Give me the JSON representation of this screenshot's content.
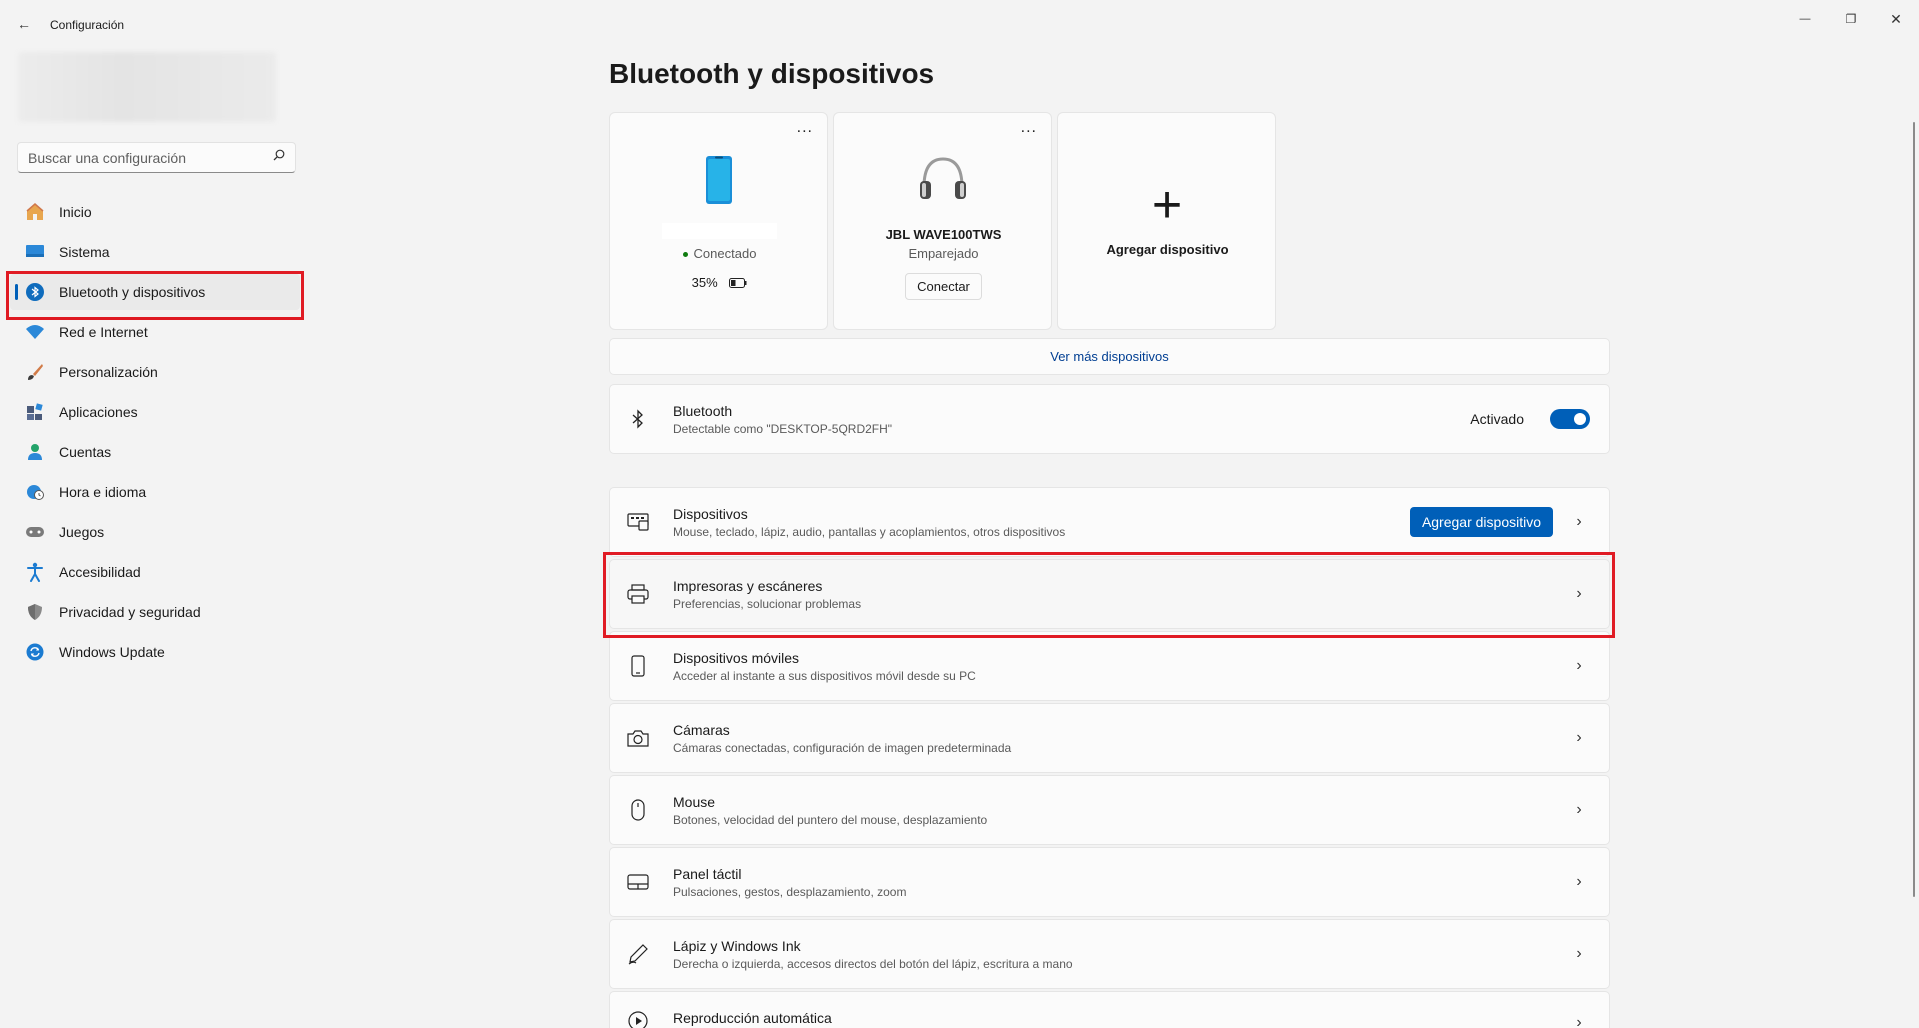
{
  "window": {
    "title": "Configuración",
    "back_glyph": "←",
    "minimize_glyph": "—",
    "restore_glyph": "❐",
    "close_glyph": "✕"
  },
  "search": {
    "placeholder": "Buscar una configuración",
    "icon": "search-icon"
  },
  "sidebar": {
    "items": [
      {
        "label": "Inicio",
        "icon": "home-icon",
        "active": false
      },
      {
        "label": "Sistema",
        "icon": "monitor-icon",
        "active": false
      },
      {
        "label": "Bluetooth y dispositivos",
        "icon": "bluetooth-icon",
        "active": true
      },
      {
        "label": "Red e Internet",
        "icon": "wifi-icon",
        "active": false
      },
      {
        "label": "Personalización",
        "icon": "brush-icon",
        "active": false
      },
      {
        "label": "Aplicaciones",
        "icon": "apps-icon",
        "active": false
      },
      {
        "label": "Cuentas",
        "icon": "person-icon",
        "active": false
      },
      {
        "label": "Hora e idioma",
        "icon": "globe-clock-icon",
        "active": false
      },
      {
        "label": "Juegos",
        "icon": "gamepad-icon",
        "active": false
      },
      {
        "label": "Accesibilidad",
        "icon": "accessibility-icon",
        "active": false
      },
      {
        "label": "Privacidad y seguridad",
        "icon": "shield-icon",
        "active": false
      },
      {
        "label": "Windows Update",
        "icon": "update-icon",
        "active": false
      }
    ]
  },
  "main": {
    "title": "Bluetooth y dispositivos",
    "devices": [
      {
        "icon": "phone-icon",
        "name": "",
        "status": "Conectado",
        "battery": "35%",
        "more": "..."
      },
      {
        "icon": "headphones-icon",
        "name": "JBL WAVE100TWS",
        "status": "Emparejado",
        "action": "Conectar",
        "more": "..."
      },
      {
        "icon": "plus-icon",
        "name": "Agregar dispositivo",
        "plus_glyph": "+"
      }
    ],
    "see_more": "Ver más dispositivos",
    "bluetooth": {
      "title": "Bluetooth",
      "subtitle": "Detectable como \"DESKTOP-5QRD2FH\"",
      "state_label": "Activado",
      "enabled": true
    },
    "rows": [
      {
        "title": "Dispositivos",
        "subtitle": "Mouse, teclado, lápiz, audio, pantallas y acoplamientos, otros dispositivos",
        "button": "Agregar dispositivo",
        "icon": "devices-icon"
      },
      {
        "title": "Impresoras y escáneres",
        "subtitle": "Preferencias, solucionar problemas",
        "icon": "printer-icon"
      },
      {
        "title": "Dispositivos móviles",
        "subtitle": "Acceder al instante a sus dispositivos móvil desde su PC",
        "icon": "mobile-icon"
      },
      {
        "title": "Cámaras",
        "subtitle": "Cámaras conectadas, configuración de imagen predeterminada",
        "icon": "camera-icon"
      },
      {
        "title": "Mouse",
        "subtitle": "Botones, velocidad del puntero del mouse, desplazamiento",
        "icon": "mouse-icon"
      },
      {
        "title": "Panel táctil",
        "subtitle": "Pulsaciones, gestos, desplazamiento, zoom",
        "icon": "touchpad-icon"
      },
      {
        "title": "Lápiz y Windows Ink",
        "subtitle": "Derecha o izquierda, accesos directos del botón del lápiz, escritura a mano",
        "icon": "pen-icon"
      },
      {
        "title": "Reproducción automática",
        "subtitle": "",
        "icon": "autoplay-icon"
      }
    ],
    "chevron_glyph": "›"
  },
  "colors": {
    "accent": "#005fb8",
    "highlight": "#e01b24",
    "connected_dot": "#0f7b0f"
  }
}
